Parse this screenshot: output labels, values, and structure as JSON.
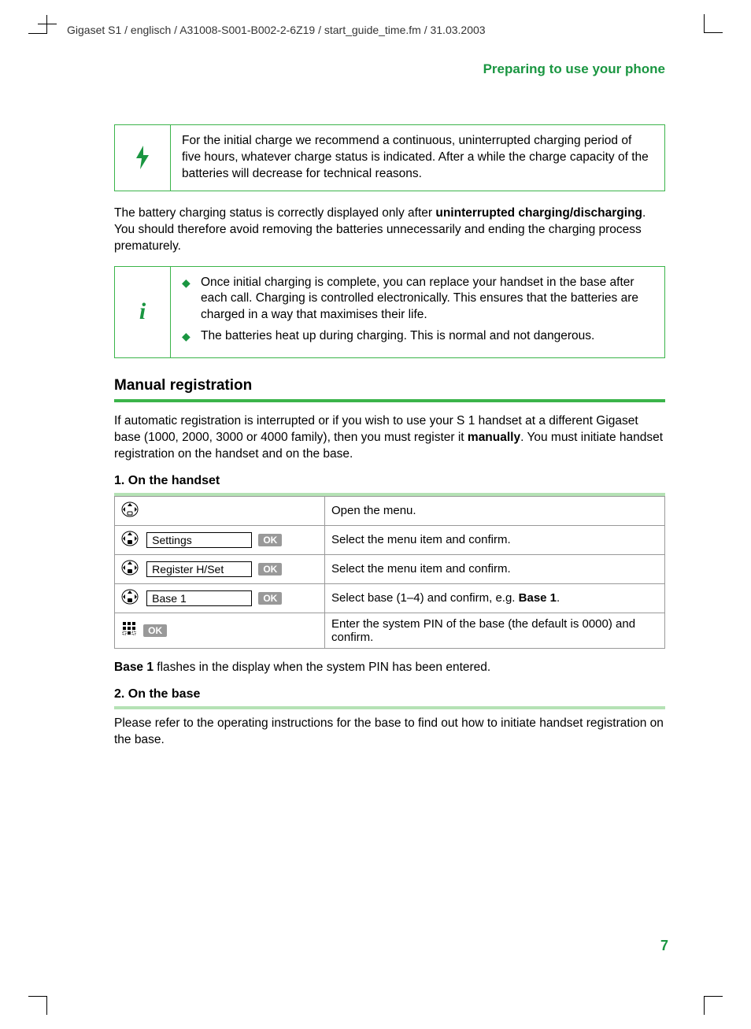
{
  "header": "Gigaset S1 / englisch / A31008-S001-B002-2-6Z19 / start_guide_time.fm / 31.03.2003",
  "section_title": "Preparing to use your phone",
  "charge_box": "For the initial charge we recommend a continuous, uninterrupted charging period of five hours, whatever charge status is indicated. After a while the charge capacity of the batteries will decrease for technical reasons.",
  "battery_para_pre": "The battery charging status is correctly displayed only after ",
  "battery_para_bold": "uninterrupted charging/discharging",
  "battery_para_post": ". You should therefore avoid removing the batteries unnecessarily and ending the charging process prematurely.",
  "info_list": {
    "i1": "Once initial charging is complete, you can replace your handset in the base after each call. Charging is controlled electronically. This ensures that the batteries are charged in a way that maximises their life.",
    "i2": "The batteries heat up during charging. This is normal and not dangerous."
  },
  "manual_heading": "Manual registration",
  "manual_para_pre": "If automatic registration is interrupted or if you wish to use your S 1 handset at a different Gigaset base (1000, 2000, 3000 or 4000 family), then you must register it ",
  "manual_para_bold": "manually",
  "manual_para_post": ". You must initiate handset registration on the handset and on the base.",
  "step1_heading": "1. On the handset",
  "table": {
    "r1d": "Open the menu.",
    "r2l": "Settings",
    "r2d": "Select the menu item and confirm.",
    "r3l": "Register H/Set",
    "r3d": "Select the menu item and confirm.",
    "r4l": "Base 1",
    "r4d_pre": "Select base (1–4) and confirm, e.g. ",
    "r4d_bold": "Base 1",
    "r4d_post": ".",
    "r5d": "Enter the system PIN of the base (the default is 0000) and confirm.",
    "ok": "OK"
  },
  "base1_pre": "Base 1",
  "base1_post": " flashes in the display when the system PIN has been entered.",
  "step2_heading": "2. On the base",
  "step2_para": "Please refer to the operating instructions for the base to find out how to initiate handset registration on the base.",
  "page_number": "7"
}
